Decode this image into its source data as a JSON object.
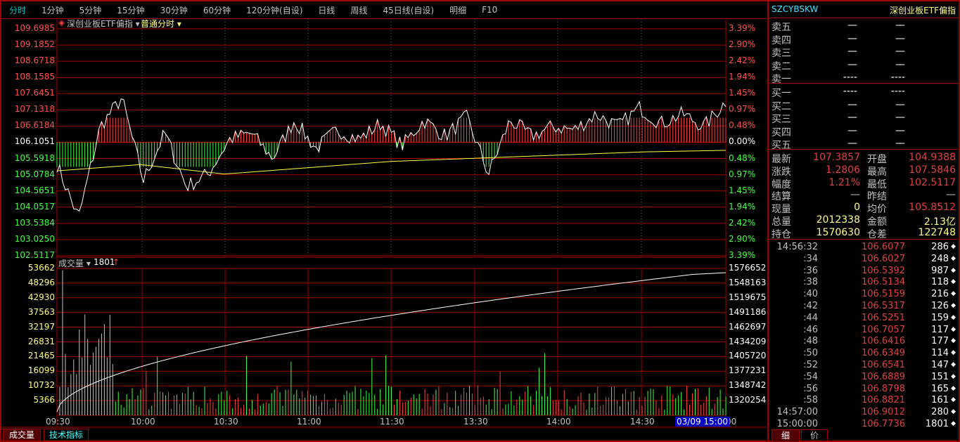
{
  "toolbar": {
    "tabs": [
      "分时",
      "1分钟",
      "5分钟",
      "15分钟",
      "30分钟",
      "60分钟",
      "120分钟(自设)",
      "日线",
      "周线",
      "45日线(自设)",
      "明细",
      "F10"
    ],
    "active": 0
  },
  "chart": {
    "symbol_label": "深创业板ETF偏指",
    "mode_label": "普通分时",
    "price_axis": [
      "109.6985",
      "109.1852",
      "108.6718",
      "108.1585",
      "107.6451",
      "107.1318",
      "106.6184",
      "106.1051",
      "105.5918",
      "105.0784",
      "104.5651",
      "104.0517",
      "103.5384",
      "103.0250",
      "102.5117"
    ],
    "pct_axis": [
      "3.39%",
      "2.90%",
      "2.42%",
      "1.94%",
      "1.45%",
      "0.97%",
      "0.48%",
      "0.00%",
      "0.48%",
      "0.97%",
      "1.45%",
      "1.94%",
      "2.42%",
      "2.90%",
      "3.39%"
    ],
    "volume_label": "成交量",
    "volume_value": "1801",
    "volume_axis": [
      "53662",
      "48296",
      "42930",
      "37563",
      "32197",
      "26831",
      "21465",
      "16099",
      "10732",
      "5366"
    ],
    "oi_axis": [
      "1576652",
      "1548163",
      "1519675",
      "1491186",
      "1462697",
      "1434209",
      "1405720",
      "1377231",
      "1348742",
      "1320254"
    ],
    "time_axis": [
      "09:30",
      "10:00",
      "10:30",
      "11:00",
      "11:30",
      "13:30",
      "14:00",
      "14:30",
      "00"
    ],
    "cursor_time": "03/09 15:00",
    "price_keypoints": [
      105.4,
      103.7,
      106.6,
      107.5,
      104.9,
      106.4,
      104.7,
      105.1,
      106.2,
      106.4,
      105.6,
      106.8,
      105.9,
      106.5,
      106.2,
      106.7,
      106.0,
      106.8,
      106.3,
      106.9,
      105.1,
      106.8,
      106.3,
      106.6,
      106.5,
      107.0,
      106.6,
      107.2,
      106.7,
      107.0,
      106.6,
      107.4
    ],
    "avg_keypoints": [
      105.2,
      105.4,
      105.1,
      105.3,
      105.5,
      105.6,
      105.7,
      105.8,
      105.85
    ],
    "colors": {
      "grid": "#a00000",
      "up": "#ff4040",
      "down": "#40ff40",
      "price": "#ffffff",
      "avg": "#ffff40"
    }
  },
  "side": {
    "code": "SZCYBSKW",
    "name": "深创业板ETF偏指",
    "sell": [
      {
        "label": "卖五",
        "p": "—",
        "v": "—"
      },
      {
        "label": "卖四",
        "p": "—",
        "v": "—"
      },
      {
        "label": "卖三",
        "p": "—",
        "v": "—"
      },
      {
        "label": "卖二",
        "p": "—",
        "v": "—"
      },
      {
        "label": "卖一",
        "p": "----",
        "v": "----"
      }
    ],
    "buy": [
      {
        "label": "买一",
        "p": "----",
        "v": "----"
      },
      {
        "label": "买二",
        "p": "—",
        "v": "—"
      },
      {
        "label": "买三",
        "p": "—",
        "v": "—"
      },
      {
        "label": "买四",
        "p": "—",
        "v": "—"
      },
      {
        "label": "买五",
        "p": "—",
        "v": "—"
      }
    ],
    "stats": [
      {
        "l1": "最新",
        "v1": "107.3857",
        "c1": "#e04040",
        "l2": "开盘",
        "v2": "104.9388",
        "c2": "#e04040"
      },
      {
        "l1": "涨跌",
        "v1": "1.2806",
        "c1": "#e04040",
        "l2": "最高",
        "v2": "107.5846",
        "c2": "#e04040"
      },
      {
        "l1": "幅度",
        "v1": "1.21%",
        "c1": "#e04040",
        "l2": "最低",
        "v2": "102.5117",
        "c2": "#e04040"
      },
      {
        "l1": "结算",
        "v1": "—",
        "c1": "#c0c0c0",
        "l2": "昨结",
        "v2": "—",
        "c2": "#c0c0c0"
      },
      {
        "l1": "现量",
        "v1": "0",
        "c1": "#ffff80",
        "l2": "均价",
        "v2": "105.8512",
        "c2": "#e04040"
      },
      {
        "l1": "总量",
        "v1": "2012338",
        "c1": "#ffff80",
        "l2": "金额",
        "v2": "2.13亿",
        "c2": "#ffff80"
      },
      {
        "l1": "持仓",
        "v1": "1570630",
        "c1": "#ffff80",
        "l2": "仓差",
        "v2": "122748",
        "c2": "#ffff80"
      }
    ],
    "ticks": [
      [
        "14:56:32",
        "106.6077",
        "286"
      ],
      [
        ":34",
        "106.6027",
        "248"
      ],
      [
        ":36",
        "106.5392",
        "987"
      ],
      [
        ":38",
        "106.5134",
        "118"
      ],
      [
        ":40",
        "106.5159",
        "216"
      ],
      [
        ":42",
        "106.5317",
        "126"
      ],
      [
        ":44",
        "106.5251",
        "159"
      ],
      [
        ":46",
        "106.7057",
        "117"
      ],
      [
        ":48",
        "106.6416",
        "177"
      ],
      [
        ":50",
        "106.6349",
        "114"
      ],
      [
        ":52",
        "106.6541",
        "147"
      ],
      [
        ":54",
        "106.6889",
        "151"
      ],
      [
        ":56",
        "106.8798",
        "165"
      ],
      [
        ":58",
        "106.8821",
        "161"
      ],
      [
        "14:57:00",
        "106.9012",
        "280"
      ],
      [
        "15:00:00",
        "106.7736",
        "1801"
      ]
    ],
    "tabs": [
      "细",
      "价"
    ]
  },
  "bottom_tabs": [
    "成交量",
    "技术指标"
  ]
}
